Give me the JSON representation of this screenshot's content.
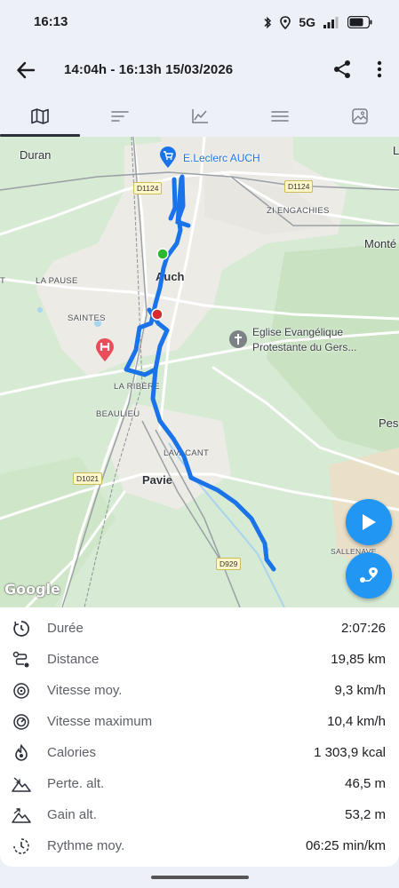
{
  "status_bar": {
    "time": "16:13",
    "network": "5G",
    "icons": [
      "bluetooth-icon",
      "location-icon",
      "signal-icon",
      "battery-icon"
    ]
  },
  "header": {
    "title": "14:04h - 16:13h  15/03/2026",
    "icons": [
      "back-arrow-icon",
      "share-icon",
      "more-vert-icon"
    ]
  },
  "tabs": [
    {
      "icon": "map-icon",
      "active": true
    },
    {
      "icon": "summary-icon",
      "active": false
    },
    {
      "icon": "chart-icon",
      "active": false
    },
    {
      "icon": "list-icon",
      "active": false
    },
    {
      "icon": "photo-icon",
      "active": false
    }
  ],
  "map": {
    "labels": {
      "duran": "Duran",
      "leclerc": "E.Leclerc AUCH",
      "zi_engachies": "ZI ENGACHIES",
      "monte": "Monté",
      "la_pause": "LA PAUSE",
      "auch": "Auch",
      "saintes": "SAINTES",
      "eglise_1": "Eglise Evangélique",
      "eglise_2": "Protestante du Gers...",
      "la_ribere": "LA RIBÈRE",
      "beaulieu": "BEAULIEU",
      "pes": "Pes",
      "lavacant": "LAVACANT",
      "pavie": "Pavie",
      "sallenave": "SALLENAVE",
      "l_edge": "L",
      "t_edge": "T",
      "google": "Google"
    },
    "roads": {
      "d1124_a": "D1124",
      "d1124_b": "D1124",
      "d1021": "D1021",
      "d929": "D929"
    },
    "route_color": "#1a73e8",
    "start_color": "#2eb82e",
    "end_color": "#d32f2f",
    "buttons": [
      "play-button",
      "route-options-button"
    ]
  },
  "stats": [
    {
      "icon": "timer-icon",
      "label": "Durée",
      "value": "2:07:26"
    },
    {
      "icon": "distance-icon",
      "label": "Distance",
      "value": "19,85 km"
    },
    {
      "icon": "speed-icon",
      "label": "Vitesse moy.",
      "value": "9,3 km/h"
    },
    {
      "icon": "max-speed-icon",
      "label": "Vitesse maximum",
      "value": "10,4 km/h"
    },
    {
      "icon": "calories-icon",
      "label": "Calories",
      "value": "1 303,9 kcal"
    },
    {
      "icon": "descent-icon",
      "label": "Perte. alt.",
      "value": "46,5 m"
    },
    {
      "icon": "ascent-icon",
      "label": "Gain alt.",
      "value": "53,2 m"
    },
    {
      "icon": "pace-icon",
      "label": "Rythme moy.",
      "value": "06:25 min/km"
    }
  ]
}
